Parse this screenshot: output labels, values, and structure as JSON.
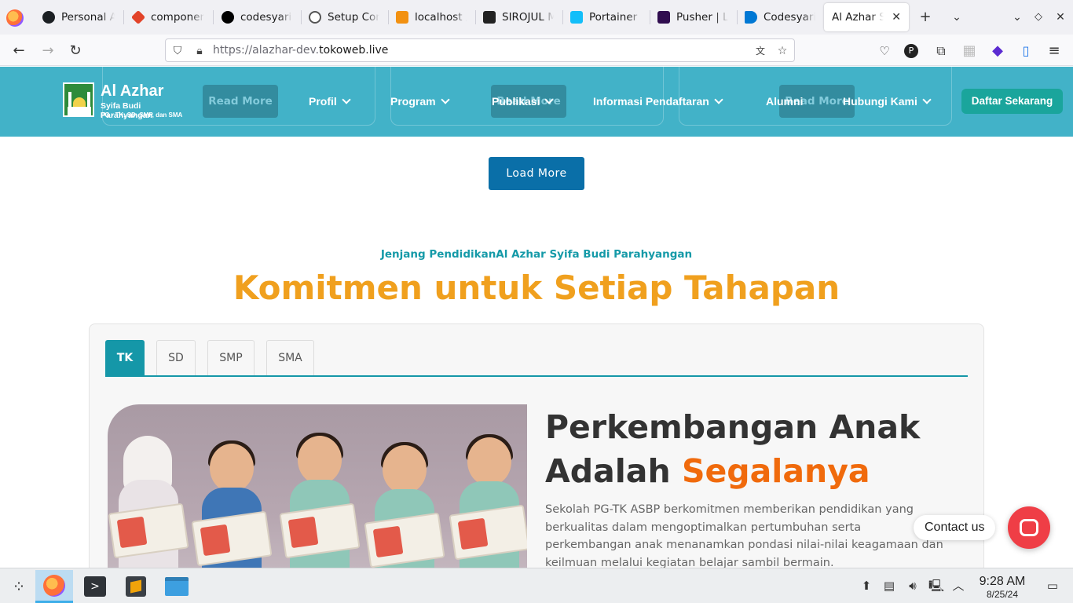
{
  "browser": {
    "tabs": [
      {
        "label": "Personal A",
        "favicon": "github-icon",
        "color": "#1b1f23"
      },
      {
        "label": "componen",
        "favicon": "gitlab-icon",
        "color": "#e24329"
      },
      {
        "label": "codesyaria",
        "favicon": "vercel-icon",
        "color": "#000000"
      },
      {
        "label": "Setup Cont",
        "favicon": "openai-icon",
        "color": "#555555"
      },
      {
        "label": "localhost /",
        "favicon": "phpmyadmin-icon",
        "color": "#f29111"
      },
      {
        "label": "SIROJUL M",
        "favicon": "sirojul-icon",
        "color": "#222222"
      },
      {
        "label": "Portainer |",
        "favicon": "portainer-icon",
        "color": "#13bef9"
      },
      {
        "label": "Pusher | L",
        "favicon": "pusher-icon",
        "color": "#300d4f"
      },
      {
        "label": "Codesyaria",
        "favicon": "azure-devops-icon",
        "color": "#0078d4"
      },
      {
        "label": "Al Azhar Syif",
        "favicon": "",
        "color": "#ffffff"
      }
    ],
    "url_prefix": "https://alazhar-dev.",
    "url_domain": "tokoweb.live"
  },
  "site": {
    "logo": {
      "title": "Al Azhar",
      "subtitle": "Syifa Budi Parahyangan",
      "tagline": "PG - TK, SD, SMP, dan SMA"
    },
    "ghost_read_more": "Read More",
    "menu": [
      {
        "label": "Profil",
        "dropdown": true
      },
      {
        "label": "Program",
        "dropdown": true
      },
      {
        "label": "Publikasi",
        "dropdown": true
      },
      {
        "label": "Informasi Pendaftaran",
        "dropdown": true
      },
      {
        "label": "Alumni",
        "dropdown": false
      },
      {
        "label": "Hubungi Kami",
        "dropdown": true
      }
    ],
    "cta": "Daftar Sekarang",
    "load_more": "Load More",
    "eyebrow": "Jenjang PendidikanAl Azhar Syifa Budi Parahyangan",
    "headline": "Komitmen untuk Setiap Tahapan",
    "level_tabs": [
      "TK",
      "SD",
      "SMP",
      "SMA"
    ],
    "active_tab": "TK",
    "feature": {
      "title_line1": "Perkembangan Anak",
      "title_line2_plain": "Adalah ",
      "title_line2_highlight": "Segalanya",
      "body": "Sekolah PG-TK ASBP berkomitmen memberikan pendidikan yang berkualitas dalam mengoptimalkan pertumbuhan serta perkembangan anak menanamkan pondasi nilai-nilai keagamaan dan keilmuan melalui kegiatan  belajar  sambil bermain."
    },
    "contact_label": "Contact us",
    "colors": {
      "header": "#42b2c8",
      "accent": "#1597a8",
      "headline": "#f0a01e",
      "highlight": "#f06a0c",
      "cta": "#1aa59c",
      "load_more": "#0a6fa8"
    }
  },
  "taskbar": {
    "apps": [
      "application-launcher-icon",
      "firefox-icon",
      "terminal-icon",
      "sublime-text-icon",
      "file-manager-icon"
    ],
    "time": "9:28 AM",
    "date": "8/25/24"
  }
}
